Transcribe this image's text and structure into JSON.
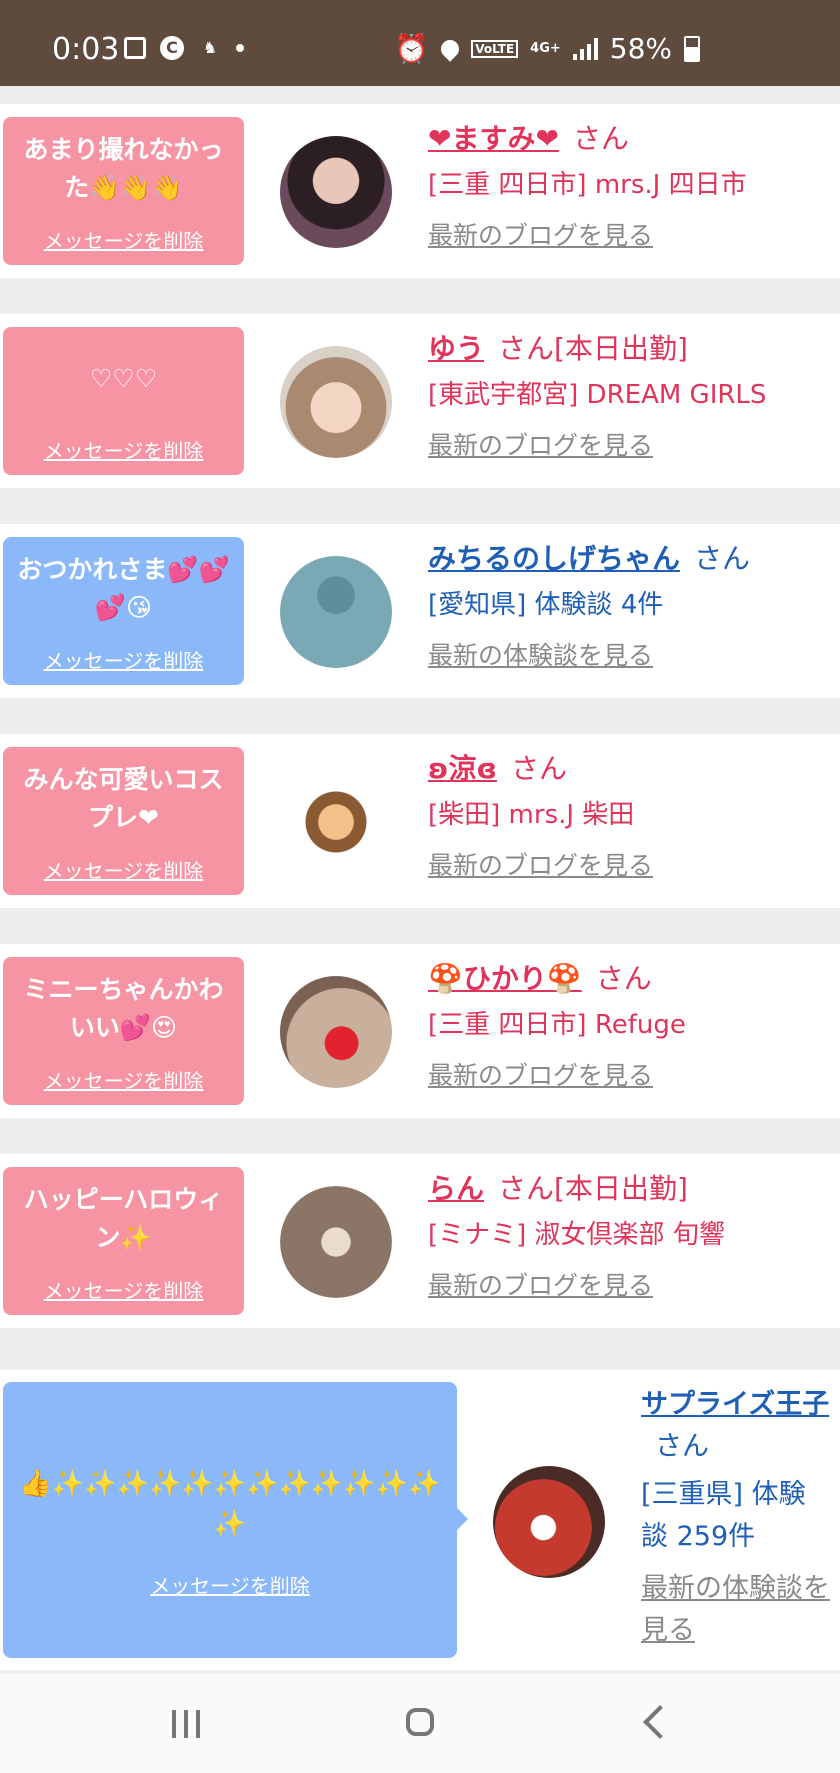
{
  "status_bar": {
    "time": "0:03",
    "battery": "58%",
    "network": "4G+",
    "volte": "VoLTE"
  },
  "cards": [
    {
      "message": "あまり撮れなかった👋👋👋",
      "delete_label": "メッセージを削除",
      "name": "❤ますみ❤",
      "suffix": "さん",
      "place": "[三重 四日市] mrs.J 四日市",
      "link": "最新のブログを見る",
      "theme": "pink",
      "avatar_color": "#6b4a5c"
    },
    {
      "message": "♡♡♡",
      "delete_label": "メッセージを削除",
      "name": "ゆう",
      "suffix": "さん[本日出勤]",
      "place": "[東武宇都宮] DREAM GIRLS",
      "link": "最新のブログを見る",
      "theme": "pink",
      "avatar_color": "#c9a58d"
    },
    {
      "message": "おつかれさま💕💕💕😘",
      "delete_label": "メッセージを削除",
      "name": "みちるのしげちゃん",
      "suffix": "さん",
      "place": "[愛知県] 体験談 4件",
      "link": "最新の体験談を見る",
      "theme": "blue",
      "avatar_color": "#7aa9b5"
    },
    {
      "message": "みんな可愛いコスプレ❤",
      "delete_label": "メッセージを削除",
      "name": "ʚ涼ɞ",
      "suffix": "さん",
      "place": "[柴田] mrs.J 柴田",
      "link": "最新のブログを見る",
      "theme": "pink",
      "avatar_color": "#f3d9d2"
    },
    {
      "message": "ミニーちゃんかわいい💕😍",
      "delete_label": "メッセージを削除",
      "name": "🍄ひかり🍄",
      "suffix": "さん",
      "place": "[三重 四日市] Refuge",
      "link": "最新のブログを見る",
      "theme": "pink",
      "avatar_color": "#b59a86"
    },
    {
      "message": "ハッピーハロウィン✨",
      "delete_label": "メッセージを削除",
      "name": "らん",
      "suffix": "さん[本日出勤]",
      "place": "[ミナミ] 淑女倶楽部 旬響",
      "link": "最新のブログを見る",
      "theme": "pink",
      "avatar_color": "#8a7567"
    }
  ],
  "big_card": {
    "message": "👍✨✨✨✨✨✨✨✨✨✨✨✨✨",
    "delete_label": "メッセージを削除",
    "name": "サプライズ王子",
    "suffix": "さん",
    "place": "[三重県] 体験談 259件",
    "link": "最新の体験談を見る",
    "avatar_color": "#c53a2e"
  }
}
